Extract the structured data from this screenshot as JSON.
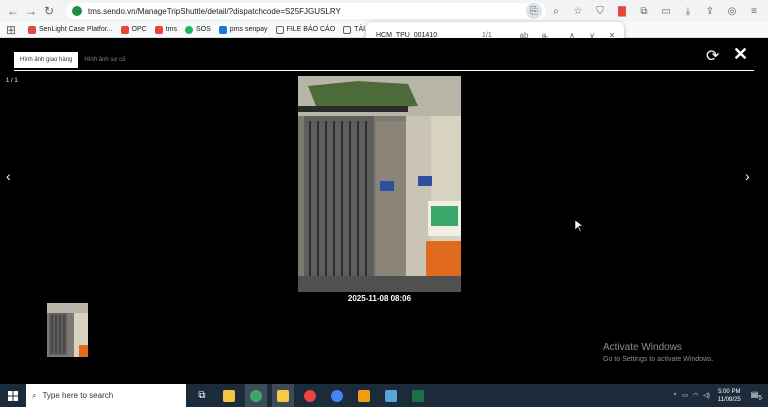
{
  "browser": {
    "url": "tms.sendo.vn/ManageTripShuttle/detail/?dispatchcode=S25FJGUSLRY",
    "bookmarks": [
      {
        "label": "SenLight Case Platfor...",
        "color": "#e8453c"
      },
      {
        "label": "OPC",
        "color": "#e8453c"
      },
      {
        "label": "tms",
        "color": "#e8453c"
      },
      {
        "label": "SOS",
        "color": "#1db954"
      },
      {
        "label": "pms senpay",
        "color": "#1a73e8"
      },
      {
        "label": "FILE BÁO CÁO",
        "color": "#5f6368"
      },
      {
        "label": "TÀI LIỆU",
        "color": "#5f6368"
      }
    ]
  },
  "find": {
    "query": "HCM_TPU_001410",
    "count": "1/1",
    "match_case_label": "ab"
  },
  "viewer": {
    "tabs": [
      {
        "label": "Hình ảnh giao hàng",
        "active": true
      },
      {
        "label": "Hình ảnh sự cố",
        "active": false
      }
    ],
    "counter": "1 / 1",
    "caption": "2025-11-08 08:06"
  },
  "watermark": {
    "title": "Activate Windows",
    "subtitle": "Go to Settings to activate Windows."
  },
  "taskbar": {
    "search_placeholder": "Type here to search",
    "time": "5:00 PM",
    "date": "11/08/25",
    "notifications": "5"
  }
}
